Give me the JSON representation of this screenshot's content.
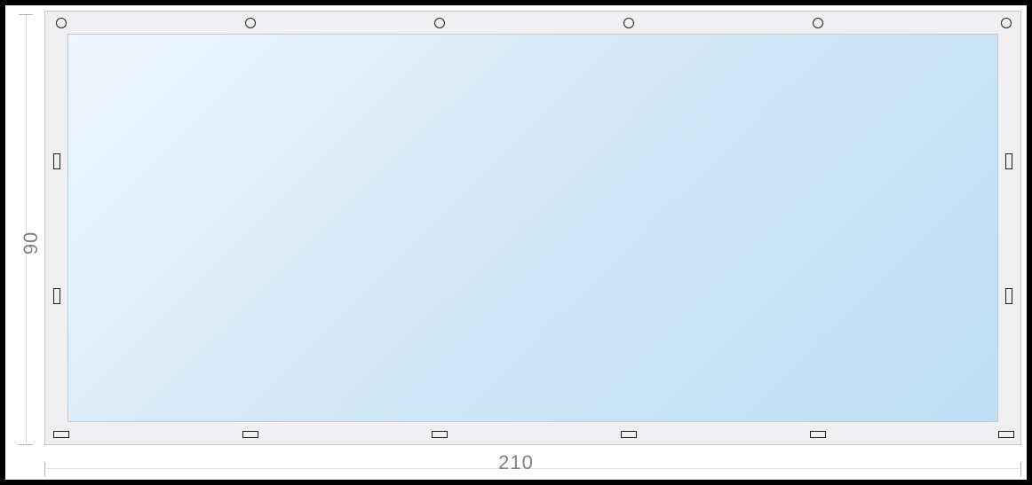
{
  "diagram": {
    "dim_height_label": "90",
    "dim_width_label": "210",
    "outer": {
      "bg": "#f0f0f2"
    },
    "glass": {
      "gradient": "blue-white"
    },
    "markers": {
      "top_circles_count": 6,
      "bottom_hrects_count": 6,
      "side_vrects_per_side": 2
    }
  }
}
